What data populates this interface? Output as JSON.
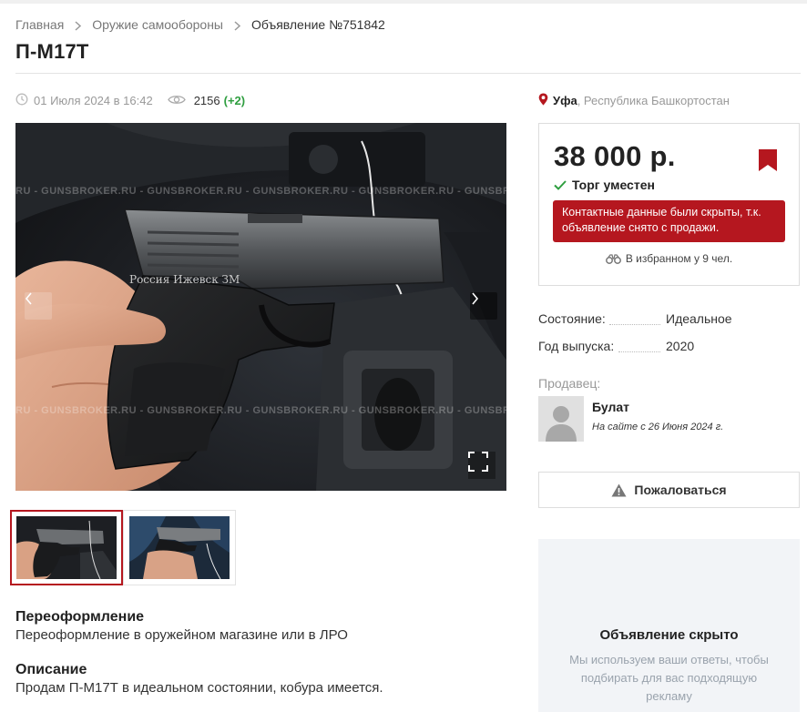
{
  "breadcrumb": {
    "items": [
      "Главная",
      "Оружие самообороны",
      "Объявление №751842"
    ]
  },
  "listing": {
    "title": "П-М17Т",
    "date": "01 Июля 2024 в 16:42",
    "views": "2156",
    "views_delta": "(+2)"
  },
  "location": {
    "city": "Уфа",
    "region": ", Республика Башкортостан"
  },
  "gallery": {
    "watermark": "RU - GUNSBROKER.RU - GUNSBROKER.RU - GUNSBROKER.RU - GUNSBROKER.RU - GUNSBROKER.RU - GUNSBROKER.RU",
    "gun_engraving": "Россия Ижевск ЗМ",
    "thumbnails_count": 2
  },
  "sections": [
    {
      "heading": "Переоформление",
      "text": "Переоформление в оружейном магазине или в ЛРО"
    },
    {
      "heading": "Описание",
      "text": "Продам П-М17Т в идеальном состоянии, кобура имеется."
    }
  ],
  "price_box": {
    "price": "38 000 р.",
    "bargain": "Торг уместен",
    "alert": "Контактные данные были скрыты, т.к. объявление снято с продажи.",
    "favorites": "В избранном у 9 чел."
  },
  "attributes": [
    {
      "label": "Состояние:",
      "value": "Идеальное"
    },
    {
      "label": "Год выпуска:",
      "value": "2020"
    }
  ],
  "seller": {
    "label": "Продавец:",
    "name": "Булат",
    "since": "На сайте с 26 Июня 2024 г."
  },
  "complain_label": "Пожаловаться",
  "ad": {
    "title": "Объявление скрыто",
    "text": "Мы используем ваши ответы, чтобы подбирать для вас подходящую рекламу"
  },
  "colors": {
    "accent_red": "#b5171f",
    "views_green": "#2e9e3f",
    "check_green": "#2e9e3f"
  },
  "icons": {
    "date": "clock-icon",
    "views": "eye-icon",
    "location": "map-pin-icon",
    "bookmark": "bookmark-icon",
    "bargain": "check-icon",
    "favorites": "binoculars-icon",
    "complain": "warning-icon",
    "gallery_prev": "chevron-left-icon",
    "gallery_next": "chevron-right-icon",
    "fullscreen": "fullscreen-icon"
  }
}
